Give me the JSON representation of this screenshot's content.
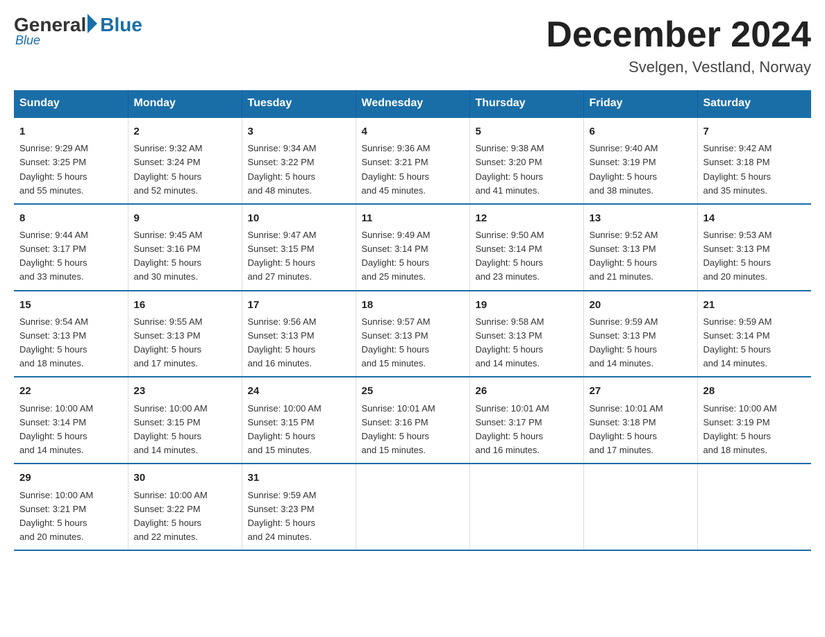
{
  "logo": {
    "general": "General",
    "blue": "Blue",
    "sub": "Blue"
  },
  "title": "December 2024",
  "location": "Svelgen, Vestland, Norway",
  "headers": [
    "Sunday",
    "Monday",
    "Tuesday",
    "Wednesday",
    "Thursday",
    "Friday",
    "Saturday"
  ],
  "weeks": [
    [
      {
        "num": "1",
        "info": "Sunrise: 9:29 AM\nSunset: 3:25 PM\nDaylight: 5 hours\nand 55 minutes."
      },
      {
        "num": "2",
        "info": "Sunrise: 9:32 AM\nSunset: 3:24 PM\nDaylight: 5 hours\nand 52 minutes."
      },
      {
        "num": "3",
        "info": "Sunrise: 9:34 AM\nSunset: 3:22 PM\nDaylight: 5 hours\nand 48 minutes."
      },
      {
        "num": "4",
        "info": "Sunrise: 9:36 AM\nSunset: 3:21 PM\nDaylight: 5 hours\nand 45 minutes."
      },
      {
        "num": "5",
        "info": "Sunrise: 9:38 AM\nSunset: 3:20 PM\nDaylight: 5 hours\nand 41 minutes."
      },
      {
        "num": "6",
        "info": "Sunrise: 9:40 AM\nSunset: 3:19 PM\nDaylight: 5 hours\nand 38 minutes."
      },
      {
        "num": "7",
        "info": "Sunrise: 9:42 AM\nSunset: 3:18 PM\nDaylight: 5 hours\nand 35 minutes."
      }
    ],
    [
      {
        "num": "8",
        "info": "Sunrise: 9:44 AM\nSunset: 3:17 PM\nDaylight: 5 hours\nand 33 minutes."
      },
      {
        "num": "9",
        "info": "Sunrise: 9:45 AM\nSunset: 3:16 PM\nDaylight: 5 hours\nand 30 minutes."
      },
      {
        "num": "10",
        "info": "Sunrise: 9:47 AM\nSunset: 3:15 PM\nDaylight: 5 hours\nand 27 minutes."
      },
      {
        "num": "11",
        "info": "Sunrise: 9:49 AM\nSunset: 3:14 PM\nDaylight: 5 hours\nand 25 minutes."
      },
      {
        "num": "12",
        "info": "Sunrise: 9:50 AM\nSunset: 3:14 PM\nDaylight: 5 hours\nand 23 minutes."
      },
      {
        "num": "13",
        "info": "Sunrise: 9:52 AM\nSunset: 3:13 PM\nDaylight: 5 hours\nand 21 minutes."
      },
      {
        "num": "14",
        "info": "Sunrise: 9:53 AM\nSunset: 3:13 PM\nDaylight: 5 hours\nand 20 minutes."
      }
    ],
    [
      {
        "num": "15",
        "info": "Sunrise: 9:54 AM\nSunset: 3:13 PM\nDaylight: 5 hours\nand 18 minutes."
      },
      {
        "num": "16",
        "info": "Sunrise: 9:55 AM\nSunset: 3:13 PM\nDaylight: 5 hours\nand 17 minutes."
      },
      {
        "num": "17",
        "info": "Sunrise: 9:56 AM\nSunset: 3:13 PM\nDaylight: 5 hours\nand 16 minutes."
      },
      {
        "num": "18",
        "info": "Sunrise: 9:57 AM\nSunset: 3:13 PM\nDaylight: 5 hours\nand 15 minutes."
      },
      {
        "num": "19",
        "info": "Sunrise: 9:58 AM\nSunset: 3:13 PM\nDaylight: 5 hours\nand 14 minutes."
      },
      {
        "num": "20",
        "info": "Sunrise: 9:59 AM\nSunset: 3:13 PM\nDaylight: 5 hours\nand 14 minutes."
      },
      {
        "num": "21",
        "info": "Sunrise: 9:59 AM\nSunset: 3:14 PM\nDaylight: 5 hours\nand 14 minutes."
      }
    ],
    [
      {
        "num": "22",
        "info": "Sunrise: 10:00 AM\nSunset: 3:14 PM\nDaylight: 5 hours\nand 14 minutes."
      },
      {
        "num": "23",
        "info": "Sunrise: 10:00 AM\nSunset: 3:15 PM\nDaylight: 5 hours\nand 14 minutes."
      },
      {
        "num": "24",
        "info": "Sunrise: 10:00 AM\nSunset: 3:15 PM\nDaylight: 5 hours\nand 15 minutes."
      },
      {
        "num": "25",
        "info": "Sunrise: 10:01 AM\nSunset: 3:16 PM\nDaylight: 5 hours\nand 15 minutes."
      },
      {
        "num": "26",
        "info": "Sunrise: 10:01 AM\nSunset: 3:17 PM\nDaylight: 5 hours\nand 16 minutes."
      },
      {
        "num": "27",
        "info": "Sunrise: 10:01 AM\nSunset: 3:18 PM\nDaylight: 5 hours\nand 17 minutes."
      },
      {
        "num": "28",
        "info": "Sunrise: 10:00 AM\nSunset: 3:19 PM\nDaylight: 5 hours\nand 18 minutes."
      }
    ],
    [
      {
        "num": "29",
        "info": "Sunrise: 10:00 AM\nSunset: 3:21 PM\nDaylight: 5 hours\nand 20 minutes."
      },
      {
        "num": "30",
        "info": "Sunrise: 10:00 AM\nSunset: 3:22 PM\nDaylight: 5 hours\nand 22 minutes."
      },
      {
        "num": "31",
        "info": "Sunrise: 9:59 AM\nSunset: 3:23 PM\nDaylight: 5 hours\nand 24 minutes."
      },
      null,
      null,
      null,
      null
    ]
  ]
}
